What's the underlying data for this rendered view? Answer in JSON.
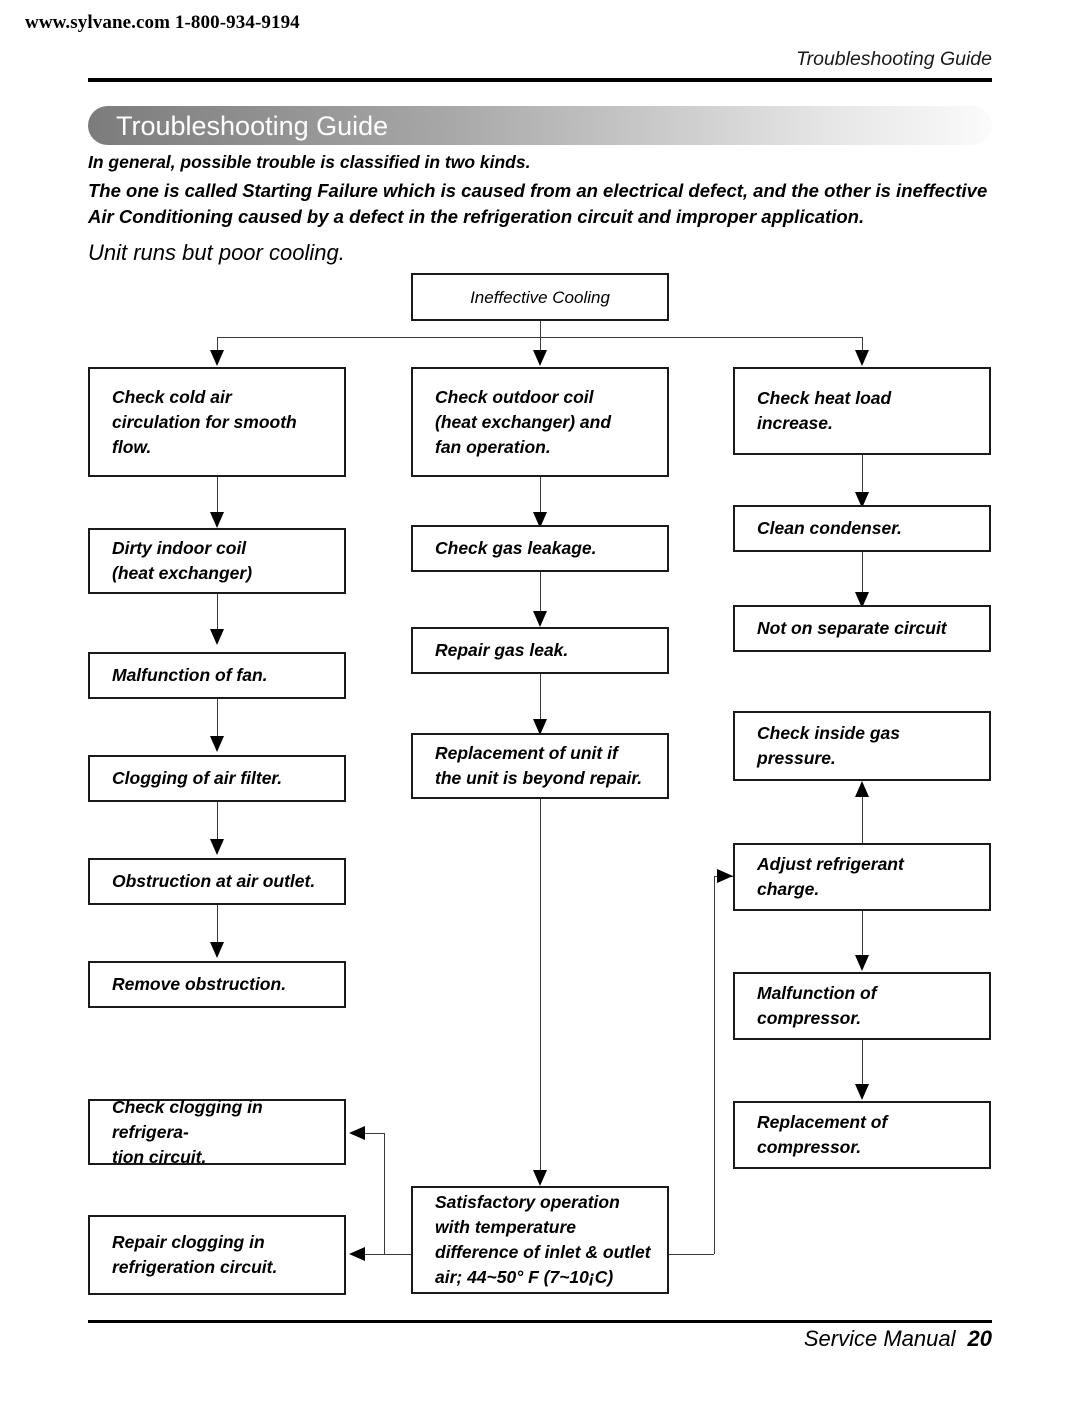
{
  "header": {
    "site": "www.sylvane.com 1-800-934-9194",
    "running_head": "Troubleshooting Guide"
  },
  "title_bar": {
    "label": "Troubleshooting Guide"
  },
  "intro": {
    "line1": "In general, possible trouble is classified in two kinds.",
    "line2": "The one is called Starting Failure which is caused from an electrical defect, and the other is ineffective Air Conditioning caused by a defect in the refrigeration circuit and improper application."
  },
  "section": {
    "heading": "Unit runs but poor cooling."
  },
  "flowchart": {
    "root": "Ineffective Cooling",
    "left_column": [
      "Check cold air circulation for smooth flow.",
      "Dirty indoor coil (heat exchanger)",
      "Malfunction of fan.",
      "Clogging of air filter.",
      "Obstruction at air outlet.",
      "Remove obstruction.",
      "Check clogging in refrigera- tion circuit.",
      "Repair clogging in refrigeration circuit."
    ],
    "middle_column": [
      "Check outdoor coil (heat exchanger) and fan operation.",
      "Check gas leakage.",
      "Repair gas leak.",
      "Replacement of unit if the unit is beyond repair.",
      "Satisfactory operation with temperature difference of inlet & outlet air; 44~50° F (7~10¡C)"
    ],
    "right_column": [
      "Check heat load increase.",
      "Clean condenser.",
      "Not on separate circuit",
      "Check inside gas pressure.",
      "Adjust refrigerant charge.",
      "Malfunction of compressor.",
      "Replacement of compressor."
    ],
    "boxes": {
      "b_check_cold_air_l1": "Check cold air",
      "b_check_cold_air_l2": "circulation for smooth",
      "b_check_cold_air_l3": "flow.",
      "b_dirty_coil_l1": "Dirty indoor coil",
      "b_dirty_coil_l2": "(heat exchanger)",
      "b_malfunction_fan": "Malfunction of fan.",
      "b_clogging_filter": "Clogging of air filter.",
      "b_obstruction_outlet": "Obstruction at air outlet.",
      "b_remove_obstruction": "Remove obstruction.",
      "b_check_clogging_l1": "Check clogging in refrigera-",
      "b_check_clogging_l2": "tion circuit.",
      "b_repair_clogging_l1": "Repair clogging in",
      "b_repair_clogging_l2": "refrigeration circuit.",
      "b_outdoor_coil_l1": "Check outdoor coil",
      "b_outdoor_coil_l2": "(heat exchanger) and",
      "b_outdoor_coil_l3": "fan operation.",
      "b_gas_leakage": "Check gas leakage.",
      "b_repair_gas_leak": "Repair gas leak.",
      "b_replacement_unit_l1": "Replacement of unit if",
      "b_replacement_unit_l2": "the unit is beyond repair.",
      "b_satisfactory_l1": "Satisfactory operation",
      "b_satisfactory_l2": "with temperature",
      "b_satisfactory_l3": "difference of inlet & outlet",
      "b_satisfactory_l4": "air; 44~50° F (7~10¡C)",
      "b_heat_load_l1": "Check heat load",
      "b_heat_load_l2": "increase.",
      "b_clean_condenser": "Clean condenser.",
      "b_not_separate_circuit": "Not on separate circuit",
      "b_inside_gas_l1": "Check inside gas",
      "b_inside_gas_l2": "pressure.",
      "b_adjust_refrig_l1": "Adjust refrigerant",
      "b_adjust_refrig_l2": "charge.",
      "b_malfunction_comp_l1": "Malfunction of",
      "b_malfunction_comp_l2": "compressor.",
      "b_replacement_comp_l1": "Replacement of",
      "b_replacement_comp_l2": "compressor."
    }
  },
  "footer": {
    "manual": "Service Manual",
    "page": "20"
  },
  "colors": {
    "ink": "#000000",
    "border": "#1a1a1a",
    "connector": "#3a3a3a",
    "pill_start": "#7c7c7c",
    "pill_end": "#fbfbfb"
  }
}
